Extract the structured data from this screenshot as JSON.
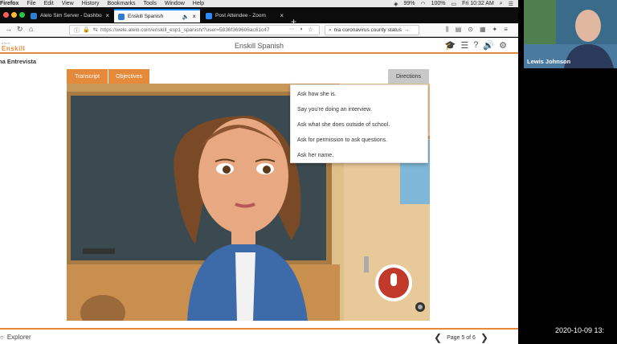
{
  "menubar": {
    "app": "Firefox",
    "items": [
      "File",
      "Edit",
      "View",
      "History",
      "Bookmarks",
      "Tools",
      "Window",
      "Help"
    ],
    "battery": "99%",
    "zoom_level": "100%",
    "clock": "Fri 10:32 AM"
  },
  "tabs": [
    {
      "label": "Alelo Sim Server - Dashboard"
    },
    {
      "label": "Enskill Spanish"
    },
    {
      "label": "Post Attendee - Zoom"
    }
  ],
  "nav": {
    "url": "https://wele.alelo.com/enskill_esp1_spanish/?user=5836f369606ac61c47",
    "search_value": "nia coronavirus county status"
  },
  "app": {
    "logo": "Enskill",
    "logo_sub": "alelo",
    "title": "Enskill Spanish",
    "subtitle": "na Entrevista",
    "transcript_label": "Transcript",
    "objectives_label": "Objectives",
    "directions_label": "Directions",
    "directions": [
      "Ask how she is.",
      "Say you're doing an interview.",
      "Ask what she does outside of school.",
      "Ask for permission to ask questions.",
      "Ask her name."
    ],
    "explorer_label": "Explorer",
    "page_label": "Page 5 of 6"
  },
  "zoom": {
    "participant_name": "Lewis Johnson",
    "timestamp": "2020-10-09 13:"
  },
  "colors": {
    "accent": "#e58a3a",
    "firefox_tab_highlight": "#0a84ff",
    "mic_button": "#c0392b"
  }
}
